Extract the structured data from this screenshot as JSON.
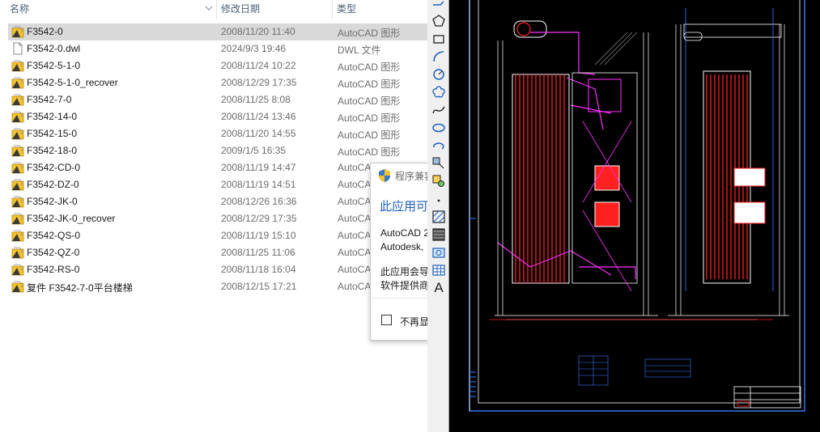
{
  "explorer": {
    "columns": {
      "name": "名称",
      "date": "修改日期",
      "type": "类型"
    },
    "files": [
      {
        "name": "F3542-0",
        "date": "2008/11/20 11:40",
        "type": "AutoCAD 图形",
        "icon": "dwg-file-icon",
        "selected": true
      },
      {
        "name": "F3542-0.dwl",
        "date": "2024/9/3 19:46",
        "type": "DWL 文件",
        "icon": "generic-file-icon"
      },
      {
        "name": "F3542-5-1-0",
        "date": "2008/11/24 10:22",
        "type": "AutoCAD 图形",
        "icon": "dwg-file-icon"
      },
      {
        "name": "F3542-5-1-0_recover",
        "date": "2008/12/29 17:35",
        "type": "AutoCAD 图形",
        "icon": "dwg-file-icon"
      },
      {
        "name": "F3542-7-0",
        "date": "2008/11/25 8:08",
        "type": "AutoCAD 图形",
        "icon": "dwg-file-icon"
      },
      {
        "name": "F3542-14-0",
        "date": "2008/11/24 13:46",
        "type": "AutoCAD 图形",
        "icon": "dwg-file-icon"
      },
      {
        "name": "F3542-15-0",
        "date": "2008/11/20 14:55",
        "type": "AutoCAD 图形",
        "icon": "dwg-file-icon"
      },
      {
        "name": "F3542-18-0",
        "date": "2009/1/5 16:35",
        "type": "AutoCAD 图形",
        "icon": "dwg-file-icon"
      },
      {
        "name": "F3542-CD-0",
        "date": "2008/11/19 14:47",
        "type": "AutoCA",
        "icon": "dwg-file-icon"
      },
      {
        "name": "F3542-DZ-0",
        "date": "2008/11/19 14:51",
        "type": "AutoCA",
        "icon": "dwg-file-icon"
      },
      {
        "name": "F3542-JK-0",
        "date": "2008/12/26 16:36",
        "type": "AutoCA",
        "icon": "dwg-file-icon"
      },
      {
        "name": "F3542-JK-0_recover",
        "date": "2008/12/29 17:35",
        "type": "AutoCA",
        "icon": "dwg-file-icon"
      },
      {
        "name": "F3542-QS-0",
        "date": "2008/11/19 15:10",
        "type": "AutoCA",
        "icon": "dwg-file-icon"
      },
      {
        "name": "F3542-QZ-0",
        "date": "2008/11/25 11:06",
        "type": "AutoCA",
        "icon": "dwg-file-icon"
      },
      {
        "name": "F3542-RS-0",
        "date": "2008/11/18 16:04",
        "type": "AutoCA",
        "icon": "dwg-file-icon"
      },
      {
        "name": "复件 F3542-7-0平台楼梯",
        "date": "2008/12/15 17:21",
        "type": "AutoCA",
        "icon": "dwg-file-icon"
      }
    ]
  },
  "dialog": {
    "title": "程序兼容",
    "heading": "此应用可",
    "line1": "AutoCAD 2",
    "line2": "Autodesk,",
    "line3": "此应用会导",
    "line4": "软件提供商",
    "checkbox_label": "不再显"
  },
  "cad": {
    "toolbar_tools": [
      "polygon-icon",
      "rectangle-icon",
      "arc-icon",
      "circle-icon",
      "revision-cloud-icon",
      "spline-icon",
      "ellipse-icon",
      "ellipse-arc-icon",
      "insert-block-icon",
      "make-block-icon",
      "point-icon",
      "hatch-icon",
      "gradient-icon",
      "region-icon",
      "table-icon",
      "multiline-text-icon"
    ],
    "text_tool_label": "A",
    "colors": {
      "background": "#000000",
      "frame": "#3a7bff",
      "tubes": "#ff2020",
      "magenta": "#ff30ff",
      "white": "#ffffff"
    }
  }
}
